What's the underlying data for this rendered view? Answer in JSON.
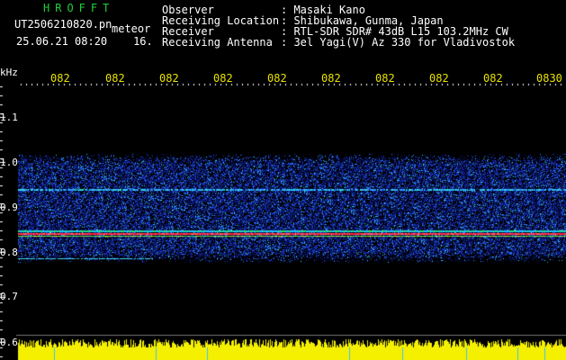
{
  "header": {
    "brand": "HROFFT",
    "filename": "UT2506210820.pn",
    "tag": "meteor",
    "datetime": "25.06.21 08:20",
    "count": "16.",
    "fields": [
      {
        "label": "Observer",
        "value": ": Masaki Kano"
      },
      {
        "label": "Receiving Location",
        "value": ": Shibukawa, Gunma, Japan"
      },
      {
        "label": "Receiver",
        "value": ": RTL-SDR SDR# 43dB L15 103.2MHz CW"
      },
      {
        "label": "Receiving Antenna",
        "value": ": 3el Yagi(V) Az 330 for Vladivostok"
      }
    ]
  },
  "axes": {
    "y_unit": "kHz",
    "y_ticks": [
      "1.1",
      "1.0",
      "0.9",
      "0.8",
      "0.7",
      "0.6"
    ],
    "x_ticks": [
      "082",
      "082",
      "082",
      "082",
      "082",
      "082",
      "082",
      "082",
      "082",
      "0830"
    ]
  },
  "colors": {
    "background": "#000000",
    "brand": "#1fd13a",
    "tick_x": "#e9e200",
    "text": "#ffffff",
    "noise_band": "#1c2fb0",
    "carrier": "#ff2040",
    "amplitude": "#f5f000"
  }
}
